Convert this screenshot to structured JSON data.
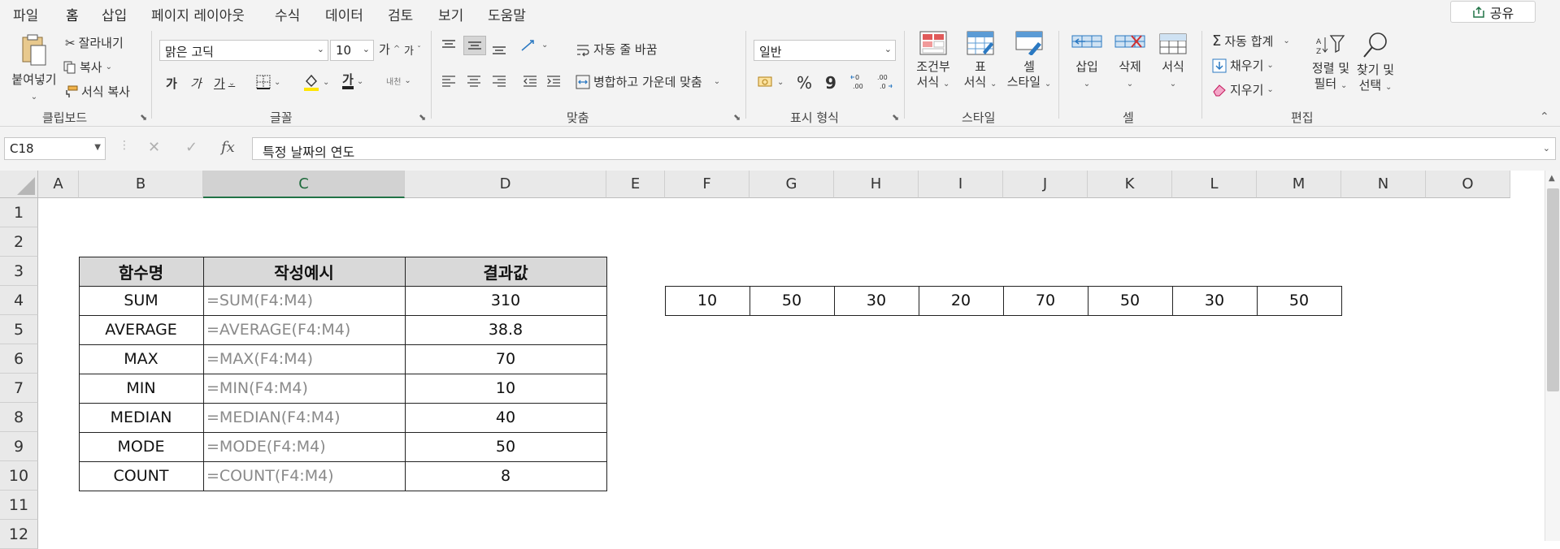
{
  "menu": {
    "tabs": [
      "파일",
      "홈",
      "삽입",
      "페이지 레이아웃",
      "수식",
      "데이터",
      "검토",
      "보기",
      "도움말"
    ],
    "share_label": "공유"
  },
  "ribbon": {
    "clipboard": {
      "paste": "붙여넣기",
      "cut": "잘라내기",
      "copy": "복사",
      "format_painter": "서식 복사",
      "label": "클립보드"
    },
    "font": {
      "name": "맑은 고딕",
      "size": "10",
      "grow": "가",
      "shrink": "가",
      "bold": "가",
      "italic": "가",
      "underline": "가",
      "font_color": "가",
      "phonetic": "내천",
      "label": "글꼴"
    },
    "alignment": {
      "wrap_text": "자동 줄 바꿈",
      "merge_center": "병합하고 가운데 맞춤",
      "label": "맞춤"
    },
    "number": {
      "format": "일반",
      "percent": "%",
      "comma": "9",
      "label": "표시 형식"
    },
    "styles": {
      "conditional_line1": "조건부",
      "conditional_line2": "서식",
      "table_line1": "표",
      "table_line2": "서식",
      "cell_line1": "셀",
      "cell_line2": "스타일",
      "label": "스타일"
    },
    "cells": {
      "insert": "삽입",
      "delete": "삭제",
      "format": "서식",
      "label": "셀"
    },
    "editing": {
      "autosum": "자동 합계",
      "fill": "채우기",
      "clear": "지우기",
      "sort_line1": "정렬 및",
      "sort_line2": "필터",
      "find_line1": "찾기 및",
      "find_line2": "선택",
      "label": "편집"
    }
  },
  "formula_bar": {
    "name_box": "C18",
    "fx": "fx",
    "content": "특정 날짜의 연도"
  },
  "sheet": {
    "columns": [
      "A",
      "B",
      "C",
      "D",
      "E",
      "F",
      "G",
      "H",
      "I",
      "J",
      "K",
      "L",
      "M",
      "N",
      "O"
    ],
    "selected_column": "C",
    "rows": [
      "1",
      "2",
      "3",
      "4",
      "5",
      "6",
      "7",
      "8",
      "9",
      "10",
      "11",
      "12"
    ],
    "table_headers": [
      "함수명",
      "작성예시",
      "결과값"
    ],
    "table_rows": [
      {
        "fn": "SUM",
        "example": "=SUM(F4:M4)",
        "result": "310"
      },
      {
        "fn": "AVERAGE",
        "example": "=AVERAGE(F4:M4)",
        "result": "38.8"
      },
      {
        "fn": "MAX",
        "example": "=MAX(F4:M4)",
        "result": "70"
      },
      {
        "fn": "MIN",
        "example": "=MIN(F4:M4)",
        "result": "10"
      },
      {
        "fn": "MEDIAN",
        "example": "=MEDIAN(F4:M4)",
        "result": "40"
      },
      {
        "fn": "MODE",
        "example": "=MODE(F4:M4)",
        "result": "50"
      },
      {
        "fn": "COUNT",
        "example": "=COUNT(F4:M4)",
        "result": "8"
      }
    ],
    "source_values": [
      "10",
      "50",
      "30",
      "20",
      "70",
      "50",
      "30",
      "50"
    ]
  },
  "colors": {
    "accent": "#217346",
    "header_fill": "#d9d9d9",
    "formula_text": "#8a8a8a"
  }
}
